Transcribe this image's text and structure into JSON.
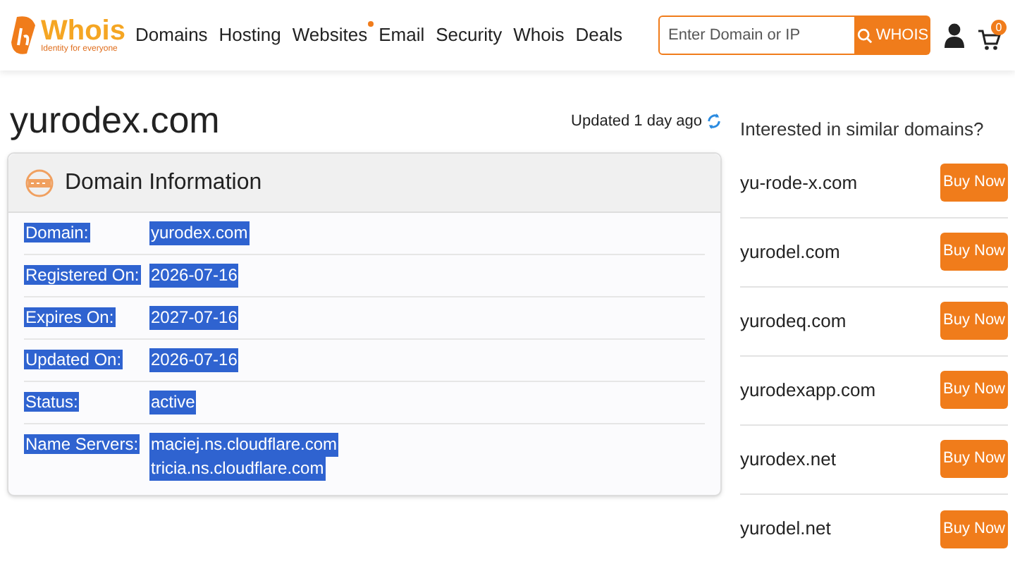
{
  "logo": {
    "name": "Whois",
    "tagline": "Identity for everyone"
  },
  "nav": [
    {
      "label": "Domains",
      "dot": false
    },
    {
      "label": "Hosting",
      "dot": false
    },
    {
      "label": "Websites",
      "dot": true
    },
    {
      "label": "Email",
      "dot": false
    },
    {
      "label": "Security",
      "dot": false
    },
    {
      "label": "Whois",
      "dot": false
    },
    {
      "label": "Deals",
      "dot": false
    }
  ],
  "search": {
    "placeholder": "Enter Domain or IP",
    "button": "WHOIS"
  },
  "cart": {
    "count": "0"
  },
  "page_title": "yurodex.com",
  "updated": "Updated 1 day ago",
  "domain_info": {
    "title": "Domain Information",
    "text_selected": true,
    "rows": [
      {
        "label": "Domain:",
        "values": [
          "yurodex.com"
        ]
      },
      {
        "label": "Registered On:",
        "values": [
          "2026-07-16"
        ]
      },
      {
        "label": "Expires On:",
        "values": [
          "2027-07-16"
        ]
      },
      {
        "label": "Updated On:",
        "values": [
          "2026-07-16"
        ]
      },
      {
        "label": "Status:",
        "values": [
          "active"
        ]
      },
      {
        "label": "Name Servers:",
        "values": [
          "maciej.ns.cloudflare.com",
          "tricia.ns.cloudflare.com"
        ]
      }
    ]
  },
  "similar": {
    "heading": "Interested in similar domains?",
    "items": [
      {
        "domain": "yu-rode-x.com",
        "button": "Buy Now"
      },
      {
        "domain": "yurodel.com",
        "button": "Buy Now"
      },
      {
        "domain": "yurodeq.com",
        "button": "Buy Now"
      },
      {
        "domain": "yurodexapp.com",
        "button": "Buy Now"
      },
      {
        "domain": "yurodex.net",
        "button": "Buy Now"
      },
      {
        "domain": "yurodel.net",
        "button": "Buy Now"
      }
    ]
  }
}
